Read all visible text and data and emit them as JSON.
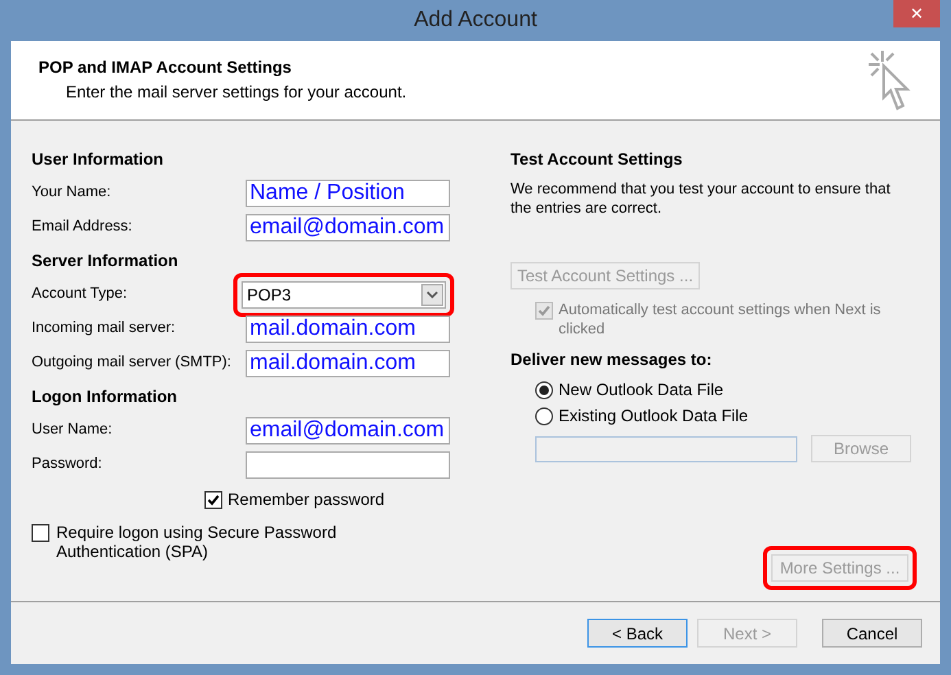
{
  "window": {
    "title": "Add Account",
    "close": "✕"
  },
  "header": {
    "title": "POP and IMAP Account Settings",
    "subtitle": "Enter the mail server settings for your account."
  },
  "sections": [
    {
      "heading": "User Information",
      "fields": [
        {
          "kind": "text",
          "label": "Your Name:",
          "value": "Name / Position"
        },
        {
          "kind": "text",
          "label": "Email Address:",
          "value": "email@domain.com"
        }
      ]
    },
    {
      "heading": "Server Information",
      "fields": [
        {
          "kind": "select",
          "label": "Account Type:",
          "value": "POP3",
          "highlighted": true
        },
        {
          "kind": "text",
          "label": "Incoming mail server:",
          "value": "mail.domain.com"
        },
        {
          "kind": "text",
          "label": "Outgoing mail server (SMTP):",
          "value": "mail.domain.com"
        }
      ]
    },
    {
      "heading": "Logon Information",
      "fields": [
        {
          "kind": "text",
          "label": "User Name:",
          "value": "email@domain.com"
        },
        {
          "kind": "text",
          "label": "Password:"
        }
      ]
    }
  ],
  "remember_password": {
    "label": "Remember password",
    "checked": true
  },
  "spa": {
    "label": "Require logon using Secure Password Authentication (SPA)",
    "checked": false
  },
  "test": {
    "heading": "Test Account Settings",
    "description": "We recommend that you test your account to ensure that the entries are correct.",
    "button": {
      "label": "Test Account Settings ...",
      "disabled": true
    },
    "auto_test": {
      "label": "Automatically test account settings when Next is clicked",
      "checked": true,
      "disabled": true
    }
  },
  "deliver": {
    "heading": "Deliver new messages to:",
    "options": [
      {
        "label": "New Outlook Data File",
        "selected": true
      },
      {
        "label": "Existing Outlook Data File",
        "selected": false
      }
    ],
    "browse": {
      "label": "Browse",
      "disabled": true
    }
  },
  "more_settings": {
    "label": "More Settings ...",
    "disabled": true,
    "highlighted": true
  },
  "buttons": [
    {
      "label": "< Back",
      "disabled": false,
      "focused": true
    },
    {
      "label": "Next >",
      "disabled": true,
      "focused": false
    },
    {
      "label": "Cancel",
      "disabled": false,
      "focused": false
    }
  ]
}
